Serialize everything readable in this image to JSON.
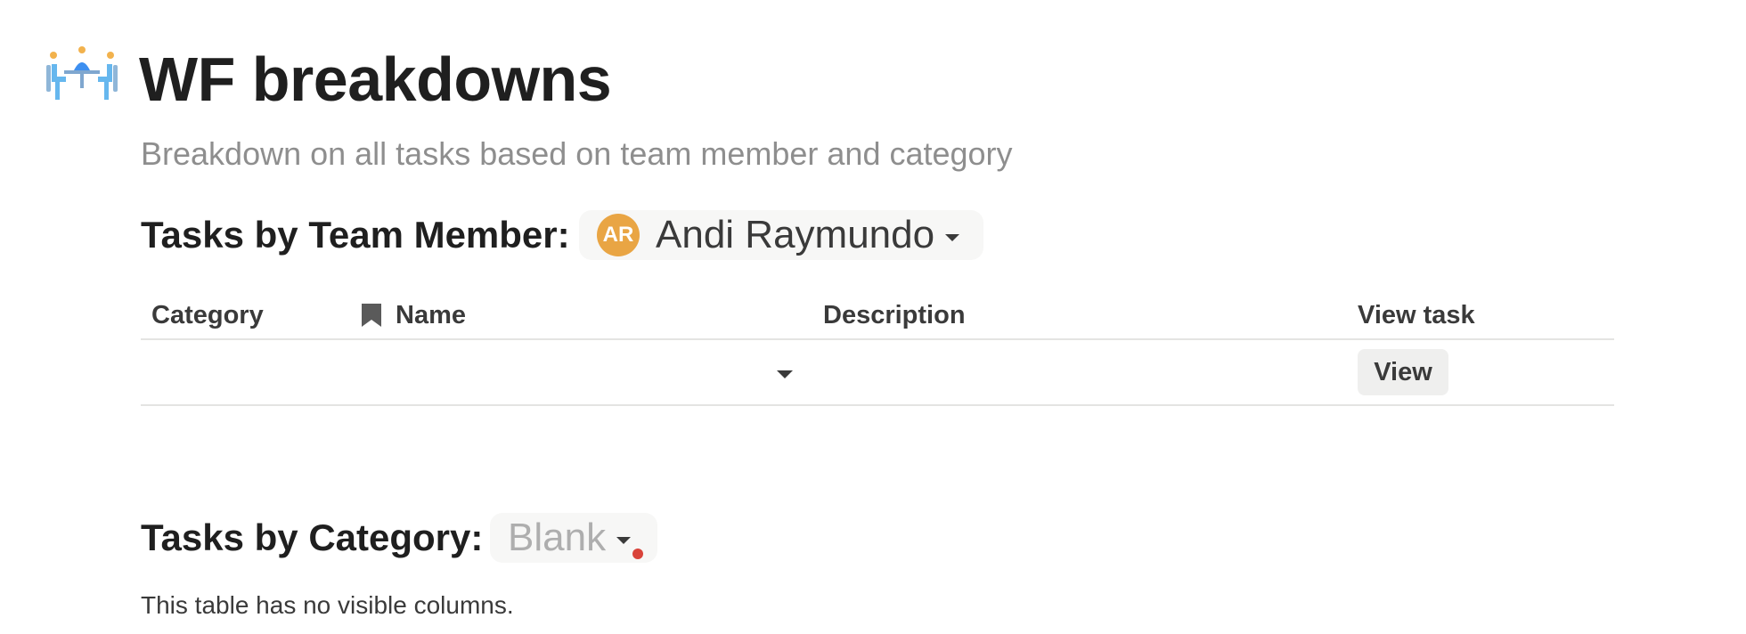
{
  "page": {
    "icon": "meeting-table-icon",
    "title": "WF breakdowns",
    "subtitle": "Breakdown on all tasks based on team member and category"
  },
  "member_section": {
    "heading": "Tasks by Team Member:",
    "selected_member": {
      "initials": "AR",
      "name": "Andi Raymundo",
      "avatar_color": "#e9a544"
    },
    "table": {
      "columns": [
        {
          "label": "Category"
        },
        {
          "label": "Name",
          "icon": "bookmark-icon"
        },
        {
          "label": "Description"
        },
        {
          "label": "View task"
        }
      ],
      "rows": [
        {
          "category": "",
          "name": "",
          "description": "",
          "view_label": "View"
        }
      ]
    }
  },
  "category_section": {
    "heading": "Tasks by Category:",
    "selected_category": "Blank",
    "empty_message": "This table has no visible columns."
  },
  "colors": {
    "text": "#1f1f1f",
    "muted_text": "#8e8e8e",
    "chip_background": "#f7f7f6",
    "alert_dot": "#d9433a"
  }
}
